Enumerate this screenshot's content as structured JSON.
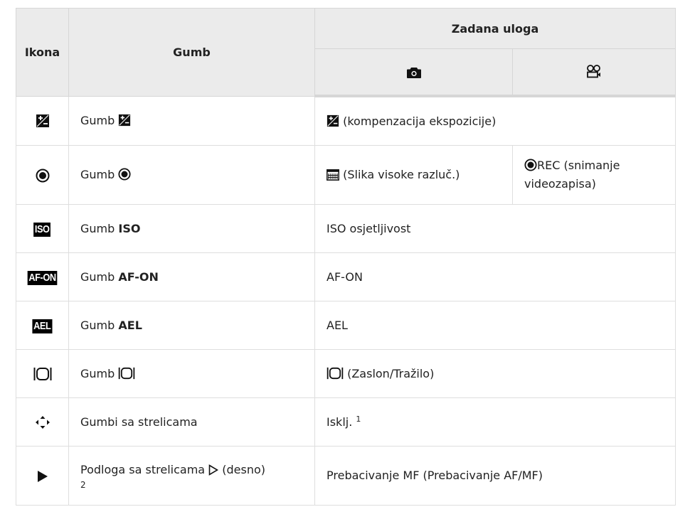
{
  "header": {
    "col_icon": "Ikona",
    "col_button": "Gumb",
    "col_default_role": "Zadana uloga",
    "photo_icon": "camera-icon",
    "video_icon": "movie-camera-icon"
  },
  "rows": [
    {
      "icon": "exposure-compensation-icon",
      "prefix": "Gumb",
      "role": "(kompenzacija ekspozicije)"
    },
    {
      "icon": "record-icon",
      "prefix": "Gumb",
      "role_photo": "(Slika visoke razluč.)",
      "role_video_1": "REC (snimanje",
      "role_video_2": "videozapisa)"
    },
    {
      "icon": "iso-badge-icon",
      "icon_text": "ISO",
      "prefix": "Gumb",
      "bold": "ISO",
      "role": "ISO osjetljivost"
    },
    {
      "icon": "af-on-badge-icon",
      "icon_text": "AF-ON",
      "prefix": "Gumb",
      "bold": "AF-ON",
      "role": "AF-ON"
    },
    {
      "icon": "ael-badge-icon",
      "icon_text": "AEL",
      "prefix": "Gumb",
      "bold": "AEL",
      "role": "AEL"
    },
    {
      "icon": "monitor-evf-icon",
      "prefix": "Gumb",
      "role": "(Zaslon/Tražilo)"
    },
    {
      "icon": "arrow-pad-icon",
      "button": "Gumbi sa strelicama",
      "role": "Isklj.",
      "role_note": "1"
    },
    {
      "icon": "play-right-icon",
      "button": "Podloga sa strelicama",
      "button_suffix": "(desno)",
      "button_note": "2",
      "role": "Prebacivanje MF (Prebacivanje AF/MF)"
    }
  ]
}
